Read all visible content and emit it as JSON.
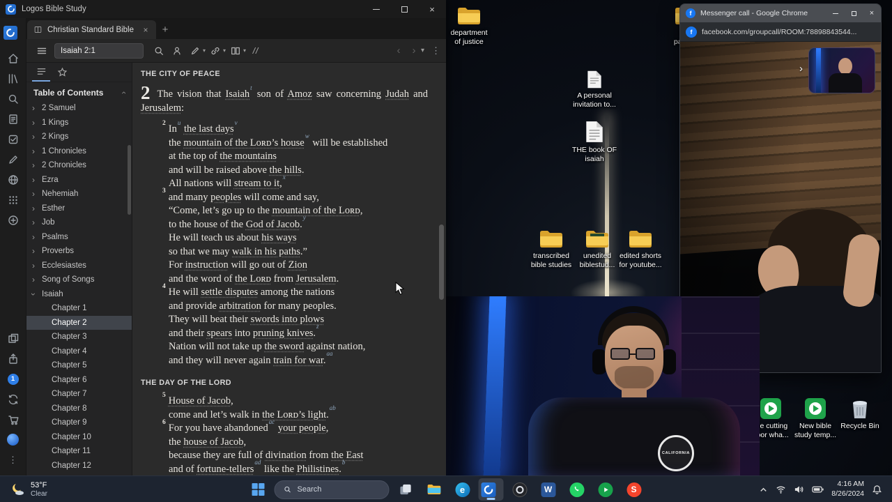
{
  "logos": {
    "window_title": "Logos Bible Study",
    "tab_title": "Christian Standard Bible",
    "reference_input": "Isaiah 2:1",
    "rail_badge": "1",
    "rail_icons": [
      "logos-logo",
      "home",
      "library",
      "search",
      "documents",
      "guides",
      "notes",
      "media",
      "apps",
      "add",
      "layouts",
      "share",
      "notifications",
      "sync",
      "store",
      "help",
      "more"
    ],
    "sidebar": {
      "header": "Table of Contents",
      "items": [
        {
          "label": "2 Samuel",
          "type": "book"
        },
        {
          "label": "1 Kings",
          "type": "book"
        },
        {
          "label": "2 Kings",
          "type": "book"
        },
        {
          "label": "1 Chronicles",
          "type": "book"
        },
        {
          "label": "2 Chronicles",
          "type": "book"
        },
        {
          "label": "Ezra",
          "type": "book"
        },
        {
          "label": "Nehemiah",
          "type": "book"
        },
        {
          "label": "Esther",
          "type": "book"
        },
        {
          "label": "Job",
          "type": "book"
        },
        {
          "label": "Psalms",
          "type": "book"
        },
        {
          "label": "Proverbs",
          "type": "book"
        },
        {
          "label": "Ecclesiastes",
          "type": "book"
        },
        {
          "label": "Song of Songs",
          "type": "book"
        },
        {
          "label": "Isaiah",
          "type": "book",
          "expanded": true
        },
        {
          "label": "Chapter 1",
          "type": "chapter"
        },
        {
          "label": "Chapter 2",
          "type": "chapter",
          "selected": true
        },
        {
          "label": "Chapter 3",
          "type": "chapter"
        },
        {
          "label": "Chapter 4",
          "type": "chapter"
        },
        {
          "label": "Chapter 5",
          "type": "chapter"
        },
        {
          "label": "Chapter 6",
          "type": "chapter"
        },
        {
          "label": "Chapter 7",
          "type": "chapter"
        },
        {
          "label": "Chapter 8",
          "type": "chapter"
        },
        {
          "label": "Chapter 9",
          "type": "chapter"
        },
        {
          "label": "Chapter 10",
          "type": "chapter"
        },
        {
          "label": "Chapter 11",
          "type": "chapter"
        },
        {
          "label": "Chapter 12",
          "type": "chapter"
        }
      ]
    },
    "content": {
      "heading1": "THE CITY OF PEACE",
      "chapter_number": "2",
      "intro": "The vision that [[Isaiah]]{t} son of [[Amoz]] saw concerning [[Judah]] and [[Jerusalem]]:",
      "poem1": [
        {
          "v": "2",
          "text": "In{u} [[the last days]]{v}"
        },
        {
          "text": "the [[mountain of the Lᴏʀᴅ’s house]]{w} will be established"
        },
        {
          "text": "at the top of [[the mountains]]"
        },
        {
          "text": "and will be raised above [[the hills]]."
        },
        {
          "text": "All nations will [[stream to it]],{x}"
        },
        {
          "v": "3",
          "text": "and many [[peoples]] will come and say,"
        },
        {
          "text": "“Come, let’s go up to the [[mountain of the Lᴏʀᴅ]],"
        },
        {
          "text": "to the house of the [[God of Jacob]].{y}"
        },
        {
          "text": "He will teach us about [[his ways]]"
        },
        {
          "text": "so that we may [[walk in his paths]].”"
        },
        {
          "text": "For [[instruction]] will go out of [[Zion]]"
        },
        {
          "text": "and the word of [[the Lᴏʀᴅ]] from [[Jerusalem]]."
        },
        {
          "v": "4",
          "text": "He will [[settle disputes]] among the nations"
        },
        {
          "text": "and provide [[arbitration]] for many peoples."
        },
        {
          "text": "They will beat their [[swords into plows]]"
        },
        {
          "text": "and their [[spears]] into [[pruning knives]].{z}"
        },
        {
          "text": "Nation will not take up [[the sword]] against nation,"
        },
        {
          "text": "and they will never again [[train for war]].{aa}"
        }
      ],
      "heading2": "THE DAY OF THE LORD",
      "poem2": [
        {
          "v": "5",
          "text": "[[House of Jacob]],"
        },
        {
          "text": "come and let’s walk in [[the Lᴏʀᴅ’s light]].{ab}"
        },
        {
          "v": "6",
          "text": "For you have abandoned{ac} [[your people]],"
        },
        {
          "text": "the [[house of Jacob]],"
        },
        {
          "text": "because they are full of [[divination]] from [[the East]]"
        },
        {
          "text": "and of [[fortune-tellers]]{ad} like the [[Philistines]].{b}"
        }
      ]
    }
  },
  "chrome": {
    "window_title": "Messenger call - Google Chrome",
    "url": "facebook.com/groupcall/ROOM:78898843544..."
  },
  "desktop": {
    "icons": [
      {
        "label": "department\nof justice",
        "type": "folder"
      },
      {
        "label": "ever\npakist...",
        "type": "folder"
      },
      {
        "label": "A personal\ninvitation to...",
        "type": "doc"
      },
      {
        "label": "THE book OF\nisaiah",
        "type": "doc"
      },
      {
        "label": "transcribed\nbible studies",
        "type": "folder"
      },
      {
        "label": "unedited\nbiblestud...",
        "type": "folder"
      },
      {
        "label": "edited shorts\nfor youtube...",
        "type": "folder"
      },
      {
        "label": "the cutting\nfloor wha...",
        "type": "green-app"
      },
      {
        "label": "New bible\nstudy temp...",
        "type": "green-app"
      },
      {
        "label": "Recycle Bin",
        "type": "recycle-bin"
      }
    ]
  },
  "webcam": {
    "shirt_text": "CALIFORNIA"
  },
  "taskbar": {
    "weather_temp": "53°F",
    "weather_desc": "Clear",
    "search_placeholder": "Search",
    "time": "4:16 AM",
    "date": "8/26/2024",
    "app_icons": [
      "start",
      "search",
      "task-view",
      "file-explorer",
      "edge",
      "logos",
      "obs",
      "word",
      "whatsapp",
      "camtasia",
      "snagit"
    ],
    "tray_icons": [
      "hidden-icons",
      "wifi",
      "volume",
      "battery",
      "bell"
    ]
  }
}
